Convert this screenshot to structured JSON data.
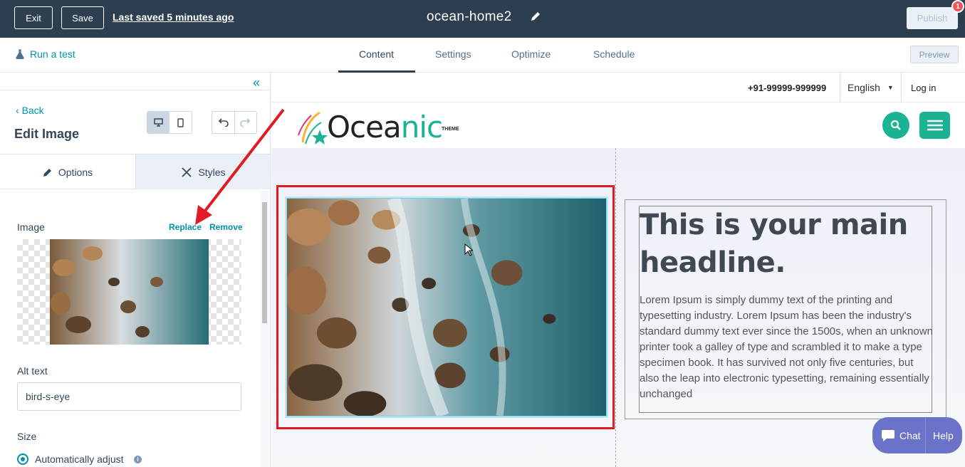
{
  "topbar": {
    "exit_label": "Exit",
    "save_label": "Save",
    "saved_status": "Last saved 5 minutes ago",
    "page_name": "ocean-home2",
    "publish_label": "Publish",
    "notification_count": "1"
  },
  "subnav": {
    "run_test": "Run a test",
    "tabs": [
      "Content",
      "Settings",
      "Optimize",
      "Schedule"
    ],
    "active_tab": "Content",
    "preview_label": "Preview"
  },
  "sidebar": {
    "back_label": "Back",
    "title": "Edit Image",
    "tab_options": "Options",
    "tab_styles": "Styles",
    "image_label": "Image",
    "replace_label": "Replace",
    "remove_label": "Remove",
    "alt_text_label": "Alt text",
    "alt_text_value": "bird-s-eye",
    "size_label": "Size",
    "size_option": "Automatically adjust"
  },
  "site": {
    "phone": "+91-99999-999999",
    "language": "English",
    "login": "Log in",
    "logo_text": "Ocea",
    "logo_accent": "nic",
    "logo_theme": "THEME",
    "headline": "This is your main headline.",
    "body": "Lorem Ipsum is simply dummy text of the printing and typesetting industry. Lorem Ipsum has been the industry's standard dummy text ever since the 1500s, when an unknown printer took a galley of type and scrambled it to make a type specimen book. It has survived not only five centuries, but also the leap into electronic typesetting, remaining essentially unchanged"
  },
  "chat": {
    "chat_label": "Chat",
    "help_label": "Help"
  },
  "colors": {
    "topbar": "#2d3e50",
    "accent": "#0091ae",
    "brand_green": "#1ab394",
    "highlight": "#e01b24",
    "chat": "#6b73c9"
  }
}
